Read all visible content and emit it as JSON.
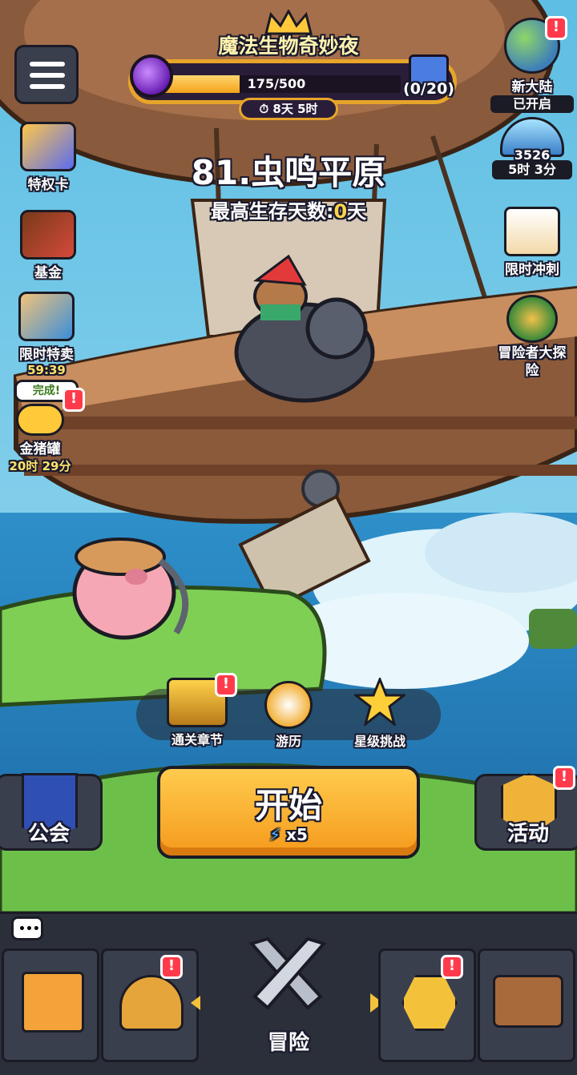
{
  "event": {
    "title": "魔法生物奇妙夜",
    "progress_text": "175/500",
    "progress_value": 0.35,
    "gift_count": "(0/20)",
    "timer": "8天 5时"
  },
  "right_panel": {
    "new_continent_label": "新大陆",
    "new_continent_status": "已开启",
    "boss_count": "3526",
    "boss_timer": "5时 3分",
    "limited_sprint": "限时冲刺",
    "adventurer": "冒险者大探险"
  },
  "left_panel": {
    "privilege_card": "特权卡",
    "fund": "基金",
    "limited_sale": "限时特卖",
    "limited_sale_timer": "59:39",
    "piggy_bank": "金猪罐",
    "piggy_bank_timer": "20时 29分",
    "piggy_bubble": "完成!"
  },
  "stage": {
    "title": "81.虫鸣平原",
    "subtitle_prefix": "最高生存天数:",
    "subtitle_value": "0",
    "subtitle_suffix": "天"
  },
  "quick": {
    "chapters": "通关章节",
    "travel": "游历",
    "star_challenge": "星级挑战"
  },
  "start": {
    "label": "开始",
    "cost": "x5"
  },
  "guild": {
    "label": "公会"
  },
  "activity": {
    "label": "活动"
  },
  "nav": {
    "adventure": "冒险"
  },
  "badge_mark": "!",
  "colors": {
    "accent": "#f59a1c",
    "badge": "#ff3b4b",
    "highlight": "#ffd34a"
  }
}
